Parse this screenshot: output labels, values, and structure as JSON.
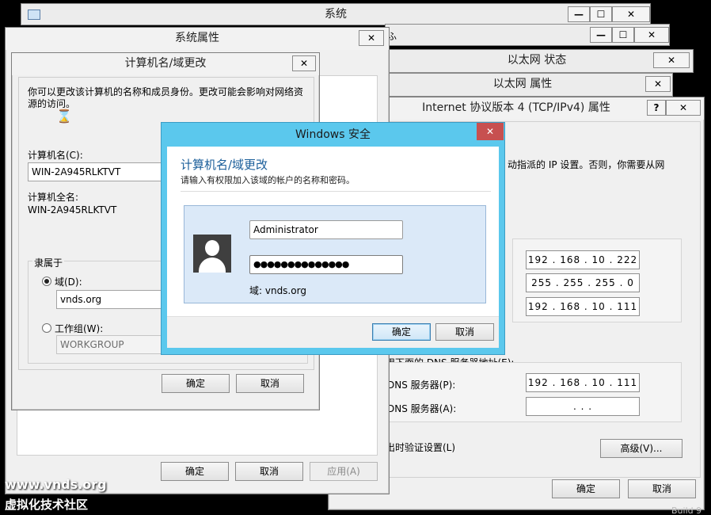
{
  "system_window": {
    "title": "系统",
    "buttons": [
      "—",
      "☐",
      "✕"
    ]
  },
  "control_panel_window": {
    "title": "",
    "buttons": [
      "—",
      "☐",
      "✕"
    ]
  },
  "ethernet_status": {
    "title": "以太网 状态",
    "close": "✕"
  },
  "ethernet_props": {
    "title": "以太网 属性",
    "close": "✕"
  },
  "ipv4_props": {
    "title": "Internet 协议版本 4 (TCP/IPv4) 属性",
    "help": "?",
    "close": "✕",
    "desc": "动指派的 IP 设置。否则，你需要从网",
    "ip": "192 . 168 . 10 . 222",
    "mask": "255 . 255 . 255 .  0",
    "gateway": "192 . 168 . 10 . 111",
    "dns_section": "用下面的 DNS 服务器地址(E):",
    "dns_pref_label": "DNS 服务器(P):",
    "dns_pref": "192 . 168 . 10 . 111",
    "dns_alt_label": "DNS 服务器(A):",
    "dns_alt": ".       .       .",
    "validate": "出时验证设置(L)",
    "advanced": "高级(V)...",
    "ok": "确定",
    "cancel": "取消"
  },
  "system_props": {
    "title": "系统属性",
    "close": "✕",
    "ok": "确定",
    "cancel": "取消",
    "apply": "应用(A)"
  },
  "computer_name": {
    "title": "计算机名/域更改",
    "close": "✕",
    "desc": "你可以更改该计算机的名称和成员身份。更改可能会影响对网络资源的访问。",
    "name_label": "计算机名(C):",
    "name_value": "WIN-2A945RLKTVT",
    "fullname_label": "计算机全名:",
    "fullname_value": "WIN-2A945RLKTVT",
    "member_label": "隶属于",
    "domain_label": "域(D):",
    "domain_value": "vnds.org",
    "workgroup_label": "工作组(W):",
    "workgroup_value": "WORKGROUP",
    "ok": "确定",
    "cancel": "取消"
  },
  "security_dialog": {
    "title": "Windows 安全",
    "close": "✕",
    "heading": "计算机名/域更改",
    "subtext": "请输入有权限加入该域的帐户的名称和密码。",
    "username": "Administrator",
    "password": "●●●●●●●●●●●●●●",
    "domain": "域: vnds.org",
    "ok": "确定",
    "cancel": "取消"
  },
  "watermark": {
    "line1": "www.vnds.org",
    "line2": "虚拟化技术社区",
    "corner": "Build 9"
  },
  "colors": {
    "accent": "#5bc8ed",
    "close_red": "#c75050",
    "heading_blue": "#1a5e9a"
  }
}
